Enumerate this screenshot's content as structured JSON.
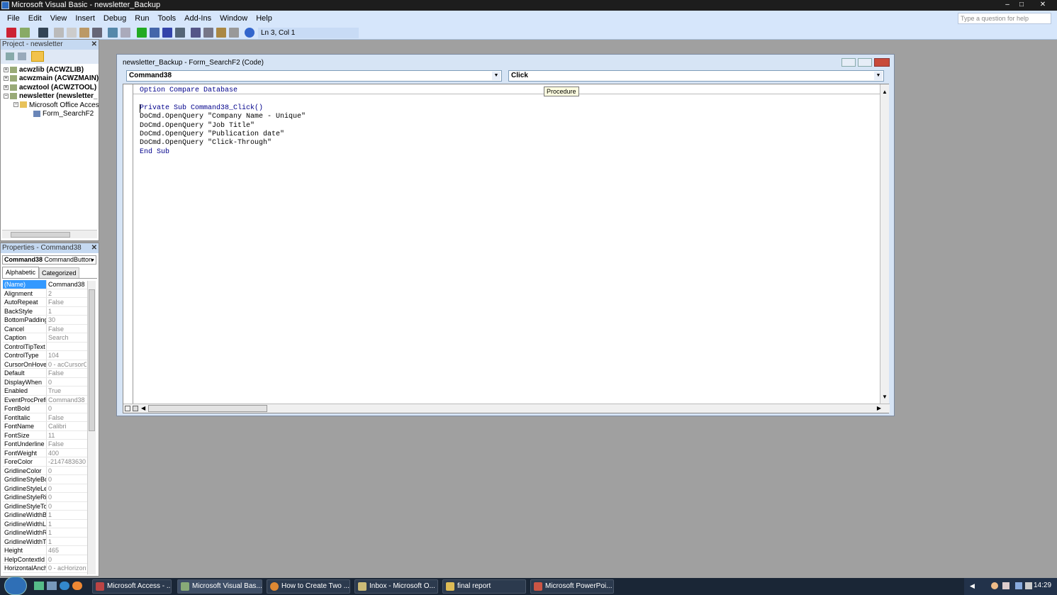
{
  "window": {
    "title": "Microsoft Visual Basic - newsletter_Backup",
    "min": "–",
    "max": "□",
    "close": "✕"
  },
  "menu": [
    "File",
    "Edit",
    "View",
    "Insert",
    "Debug",
    "Run",
    "Tools",
    "Add-Ins",
    "Window",
    "Help"
  ],
  "help_placeholder": "Type a question for help",
  "status": {
    "position": "Ln 3, Col 1"
  },
  "project": {
    "title": "Project - newsletter",
    "items": [
      {
        "label": "acwzlib (ACWZLIB)"
      },
      {
        "label": "acwzmain (ACWZMAIN)"
      },
      {
        "label": "acwztool (ACWZTOOL)"
      },
      {
        "label": "newsletter (newsletter_"
      },
      {
        "label": "Microsoft Office Access C"
      },
      {
        "label": "Form_SearchF2"
      }
    ]
  },
  "properties": {
    "title": "Properties - Command38",
    "object": "Command38",
    "object_type": "CommandButton",
    "tabs": [
      "Alphabetic",
      "Categorized"
    ],
    "rows": [
      {
        "k": "(Name)",
        "v": "Command38"
      },
      {
        "k": "Alignment",
        "v": "2"
      },
      {
        "k": "AutoRepeat",
        "v": "False"
      },
      {
        "k": "BackStyle",
        "v": "1"
      },
      {
        "k": "BottomPadding",
        "v": "30"
      },
      {
        "k": "Cancel",
        "v": "False"
      },
      {
        "k": "Caption",
        "v": "Search"
      },
      {
        "k": "ControlTipText",
        "v": ""
      },
      {
        "k": "ControlType",
        "v": "104"
      },
      {
        "k": "CursorOnHover",
        "v": "0 - acCursorOn"
      },
      {
        "k": "Default",
        "v": "False"
      },
      {
        "k": "DisplayWhen",
        "v": "0"
      },
      {
        "k": "Enabled",
        "v": "True"
      },
      {
        "k": "EventProcPrefix",
        "v": "Command38"
      },
      {
        "k": "FontBold",
        "v": "0"
      },
      {
        "k": "FontItalic",
        "v": "False"
      },
      {
        "k": "FontName",
        "v": "Calibri"
      },
      {
        "k": "FontSize",
        "v": "11"
      },
      {
        "k": "FontUnderline",
        "v": "False"
      },
      {
        "k": "FontWeight",
        "v": "400"
      },
      {
        "k": "ForeColor",
        "v": "-2147483630"
      },
      {
        "k": "GridlineColor",
        "v": "0"
      },
      {
        "k": "GridlineStyleBot",
        "v": "0"
      },
      {
        "k": "GridlineStyleLeft",
        "v": "0"
      },
      {
        "k": "GridlineStyleRigh",
        "v": "0"
      },
      {
        "k": "GridlineStyleTop",
        "v": "0"
      },
      {
        "k": "GridlineWidthBo",
        "v": "1"
      },
      {
        "k": "GridlineWidthLef",
        "v": "1"
      },
      {
        "k": "GridlineWidthRig",
        "v": "1"
      },
      {
        "k": "GridlineWidthTo",
        "v": "1"
      },
      {
        "k": "Height",
        "v": "465"
      },
      {
        "k": "HelpContextId",
        "v": "0"
      },
      {
        "k": "HorizontalAnchor",
        "v": "0 - acHorizonta"
      }
    ]
  },
  "code_window": {
    "title": "newsletter_Backup - Form_SearchF2 (Code)",
    "object_combo": "Command38",
    "proc_combo": "Click",
    "tooltip": "Procedure",
    "lines": [
      "Option Compare Database",
      "",
      "Private Sub Command38_Click()",
      "DoCmd.OpenQuery \"Company Name - Unique\"",
      "DoCmd.OpenQuery \"Job Title\"",
      "DoCmd.OpenQuery \"Publication date\"",
      "DoCmd.OpenQuery \"Click-Through\"",
      "End Sub"
    ]
  },
  "taskbar": {
    "items": [
      "Microsoft Access - ...",
      "Microsoft Visual Bas...",
      "How to Create Two ...",
      "Inbox - Microsoft O...",
      "final report",
      "Microsoft PowerPoi..."
    ],
    "time": "14:29"
  }
}
